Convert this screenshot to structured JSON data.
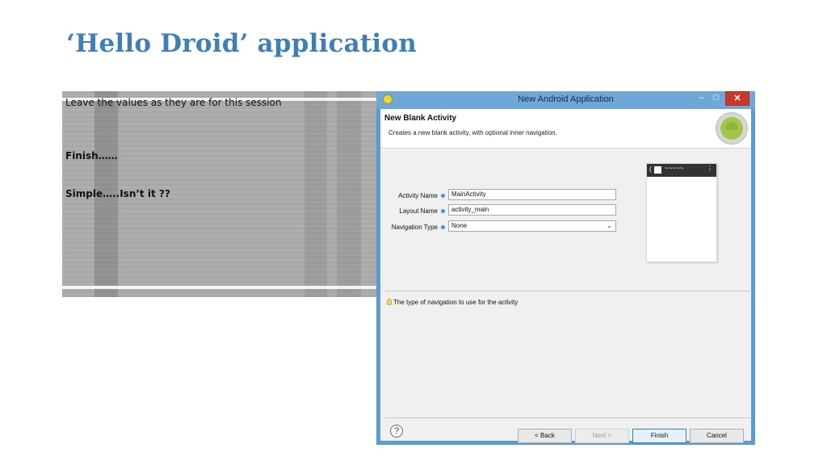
{
  "slide": {
    "title": "‘Hello Droid’ application",
    "notes": [
      "Leave the values as they are for this session",
      "Finish……",
      "Simple…..Isn’t it ??"
    ]
  },
  "dialog": {
    "window_title": "New Android Application",
    "window_controls": {
      "minimize": "–",
      "maximize": "□",
      "close": "✕"
    },
    "header": {
      "title": "New Blank Activity",
      "description": "Creates a new blank activity, with optional inner navigation."
    },
    "fields": {
      "activity_name": {
        "label": "Activity Name",
        "value": "MainActivity"
      },
      "layout_name": {
        "label": "Layout Name",
        "value": "activity_main"
      },
      "navigation_type": {
        "label": "Navigation Type",
        "value": "None",
        "arrow": "⌄"
      }
    },
    "preview": {
      "back": "(",
      "title_wave": "~~~~~",
      "menu": "⋮"
    },
    "hint": "The type of navigation to use for the activity",
    "buttons": {
      "help": "?",
      "back": "< Back",
      "next": "Next >",
      "finish": "Finish",
      "cancel": "Cancel"
    }
  }
}
